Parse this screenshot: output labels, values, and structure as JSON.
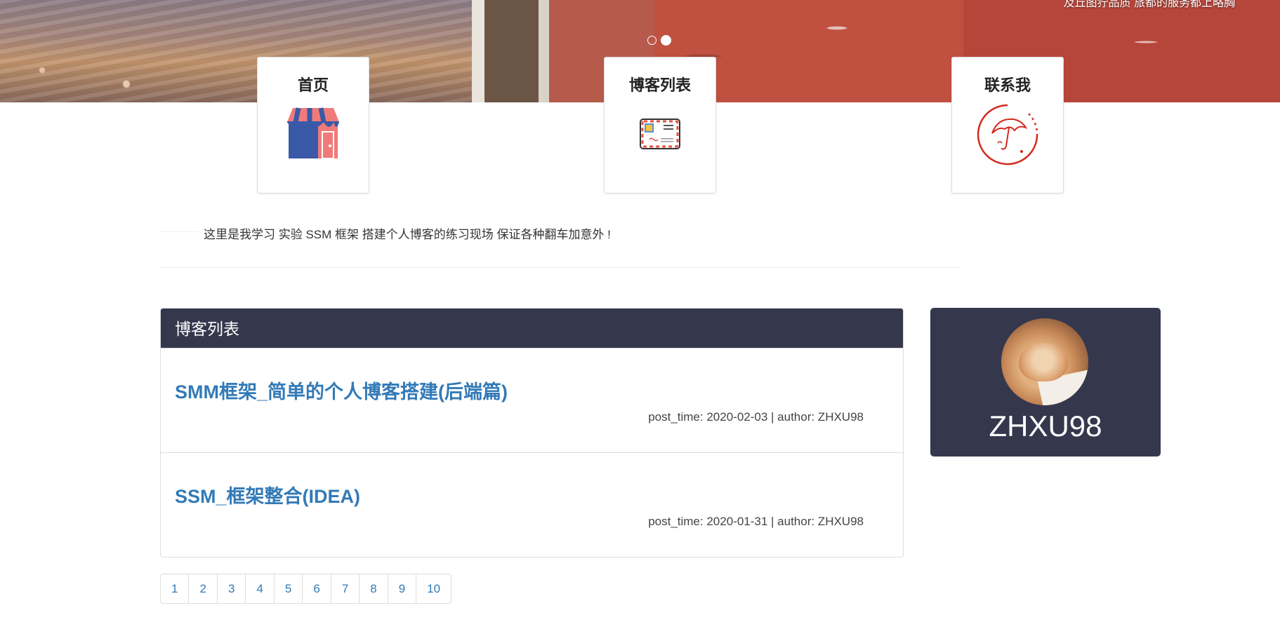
{
  "hero": {
    "caption": "及丘图狞品质 旅都的服务都上略胸",
    "dots": [
      {
        "active": false
      },
      {
        "active": true
      }
    ]
  },
  "nav_cards": [
    {
      "id": "card-home",
      "label": "首页",
      "icon": "storefront-icon"
    },
    {
      "id": "card-blog",
      "label": "博客列表",
      "icon": "airmail-envelope-icon"
    },
    {
      "id": "card-contact",
      "label": "联系我",
      "icon": "umbrella-circle-icon"
    }
  ],
  "intro": {
    "text": "这里是我学习 实验 SSM 框架 搭建个人博客的练习现场 保证各种翻车加意外 !"
  },
  "blog_list": {
    "heading": "博客列表",
    "posts": [
      {
        "title": "SMM框架_简单的个人博客搭建(后端篇)",
        "meta": "post_time: 2020-02-03 | author: ZHXU98"
      },
      {
        "title": "SSM_框架整合(IDEA)",
        "meta": "post_time: 2020-01-31 | author: ZHXU98"
      }
    ]
  },
  "profile": {
    "name": "ZHXU98"
  },
  "pagination": {
    "pages": [
      "1",
      "2",
      "3",
      "4",
      "5",
      "6",
      "7",
      "8",
      "9",
      "10"
    ]
  },
  "colors": {
    "panel_header": "#35374d",
    "link": "#337ab7",
    "contact_red": "#d4281e",
    "shop_blue": "#3a5aa8",
    "shop_pink": "#f07a7a"
  }
}
